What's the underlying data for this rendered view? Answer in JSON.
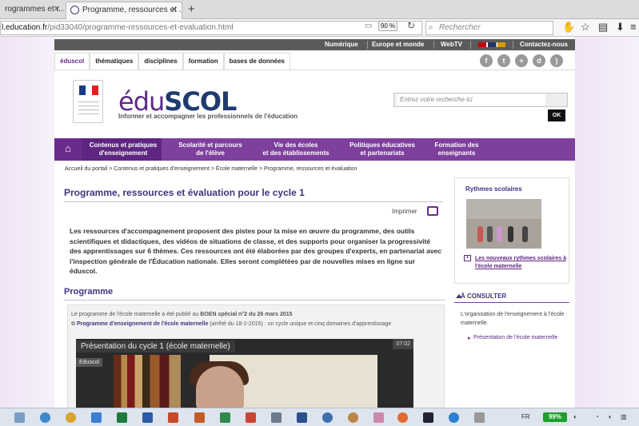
{
  "browser": {
    "tabs": [
      {
        "label": "rogrammes et r..."
      },
      {
        "label": "Programme, ressources et ..."
      }
    ],
    "url_host": "l.education.fr",
    "url_path": "/pid33040/programme-ressources-et-evaluation.html",
    "zoom": "90 %",
    "search_placeholder": "Rechercher"
  },
  "topbar": {
    "links": [
      "Numérique",
      "Europe et monde",
      "WebTV",
      "Contactez-nous"
    ]
  },
  "subtabs": [
    "éduscol",
    "thématiques",
    "disciplines",
    "formation",
    "bases de données"
  ],
  "header": {
    "brand_edu": "édu",
    "brand_scol": "SCOL",
    "tagline": "Informer et accompagner les professionnels de l'éducation",
    "search_placeholder": "Entrez votre recherche ici",
    "ok_label": "OK"
  },
  "mainnav": [
    {
      "l1": "Contenus et pratiques",
      "l2": "d'enseignement"
    },
    {
      "l1": "Scolarité et parcours",
      "l2": "de l'élève"
    },
    {
      "l1": "Vie des écoles",
      "l2": "et des établissements"
    },
    {
      "l1": "Politiques éducatives",
      "l2": "et partenariats"
    },
    {
      "l1": "Formation des",
      "l2": "enseignants"
    }
  ],
  "breadcrumb": "Accueil du portail > Contenus et pratiques d'enseignement > École maternelle > Programme, ressources et évaluation",
  "content": {
    "title": "Programme, ressources et évaluation pour le cycle 1",
    "print_label": "Imprimer",
    "intro": "Les ressources d'accompagnement proposent des pistes pour la mise en œuvre du programme, des outils scientifiques et didactiques, des vidéos de situations de classe, et des supports pour organiser la progressivité des apprentissages sur 6 thèmes. Ces ressources ont été élaborées par des groupes d'experts, en partenariat avec l'inspection générale de l'Éducation nationale. Elles seront complétées par de nouvelles mises en ligne sur éduscol.",
    "programme_heading": "Programme",
    "prog_line1_a": "Le programme de l'école maternelle a été publié au ",
    "prog_line1_b": "BOEN spécial n°2 du 26 mars 2015",
    "prog_link": "Programme d'enseignement de l'école maternelle",
    "prog_line2_rest": " (arrêté du 18-2-2015) : un cycle unique et cinq domaines d'apprentissage",
    "video_title": "Présentation du cycle 1 (école maternelle)",
    "video_tag": "Eduscol",
    "video_time": "07:02"
  },
  "aside": {
    "box_title": "Rythmes scolaires",
    "box_link": "Les nouveaux rythmes scolaires à l'école maternelle",
    "consult_title": "À CONSULTER",
    "consult_text": "L'organisation de l'enseignement à l'école maternelle.",
    "consult_link": "Présentation de l'école maternelle"
  },
  "taskbar": {
    "lang": "FR",
    "battery": "99%"
  },
  "colors": {
    "accent": "#7e3f9d",
    "title": "#3d3580"
  }
}
